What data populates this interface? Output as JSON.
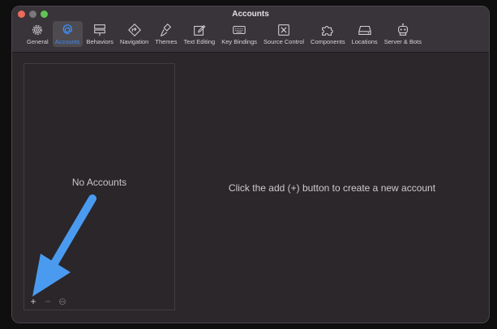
{
  "window": {
    "title": "Accounts"
  },
  "toolbar": {
    "items": [
      {
        "label": "General",
        "icon": "gear-icon"
      },
      {
        "label": "Accounts",
        "icon": "at-sign-icon",
        "selected": true
      },
      {
        "label": "Behaviors",
        "icon": "behaviors-icon"
      },
      {
        "label": "Navigation",
        "icon": "navigation-icon"
      },
      {
        "label": "Themes",
        "icon": "brush-icon"
      },
      {
        "label": "Text Editing",
        "icon": "pencil-square-icon"
      },
      {
        "label": "Key Bindings",
        "icon": "keyboard-icon"
      },
      {
        "label": "Source Control",
        "icon": "source-control-icon"
      },
      {
        "label": "Components",
        "icon": "puzzle-icon"
      },
      {
        "label": "Locations",
        "icon": "drive-icon"
      },
      {
        "label": "Server & Bots",
        "icon": "robot-icon"
      }
    ]
  },
  "accounts_list": {
    "empty_text": "No Accounts",
    "controls": {
      "add": "+",
      "remove": "−",
      "more": "⊖"
    }
  },
  "detail": {
    "hint": "Click the add (+) button to create a new account"
  },
  "colors": {
    "accent": "#3c8bf5",
    "annotation_arrow": "#4a9bf0"
  }
}
